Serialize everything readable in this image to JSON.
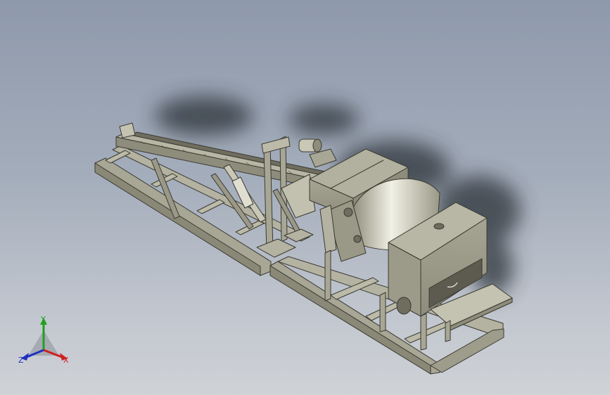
{
  "triad": {
    "y_label": "Y",
    "x_label": "X",
    "z_label": "Z",
    "colors": {
      "x": "#d02020",
      "y": "#20a020",
      "z": "#2030c0"
    }
  },
  "scene": {
    "colors": {
      "background_top": "#8e99ab",
      "background_bottom": "#cfd2d6",
      "steel_light": "#bcbaa8",
      "steel_mid": "#9a9886",
      "steel_dark": "#6f6d5e",
      "edge": "#3a3a32",
      "shadow": "#2c3038"
    }
  }
}
